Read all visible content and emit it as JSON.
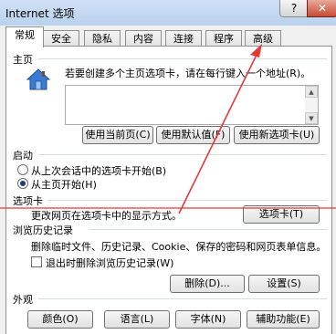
{
  "window": {
    "title": "Internet 选项",
    "help": "?",
    "close": "✕"
  },
  "tabs": [
    "常规",
    "安全",
    "隐私",
    "内容",
    "连接",
    "程序",
    "高级"
  ],
  "homepage": {
    "label": "主页",
    "instruction": "若要创建多个主页选项卡，请在每行键入一个地址(R)。",
    "value": "",
    "buttons": {
      "current": "使用当前页(C)",
      "default": "使用默认值(F)",
      "new_tab": "使用新选项卡(U)"
    }
  },
  "startup": {
    "label": "启动",
    "option_last": "从上次会话中的选项卡开始(B)",
    "option_home": "从主页开始(H)",
    "selected": "option_home"
  },
  "tabs_section": {
    "label": "选项卡",
    "description": "更改网页在选项卡中的显示方式。",
    "button": "选项卡(T)"
  },
  "history": {
    "label": "浏览历史记录",
    "description": "删除临时文件、历史记录、Cookie、保存的密码和网页表单信息。",
    "checkbox_label": "退出时删除浏览历史记录(W)",
    "checkbox_checked": false,
    "delete_button": "删除(D)...",
    "settings_button": "设置(S)"
  },
  "appearance": {
    "label": "外观",
    "buttons": {
      "colors": "颜色(O)",
      "languages": "语言(L)",
      "fonts": "字体(N)",
      "accessibility": "辅助功能(E)"
    }
  },
  "colors": {
    "annotation": "#e53935",
    "title_bar": "#c4d8f1",
    "close_button": "#c74b33"
  }
}
